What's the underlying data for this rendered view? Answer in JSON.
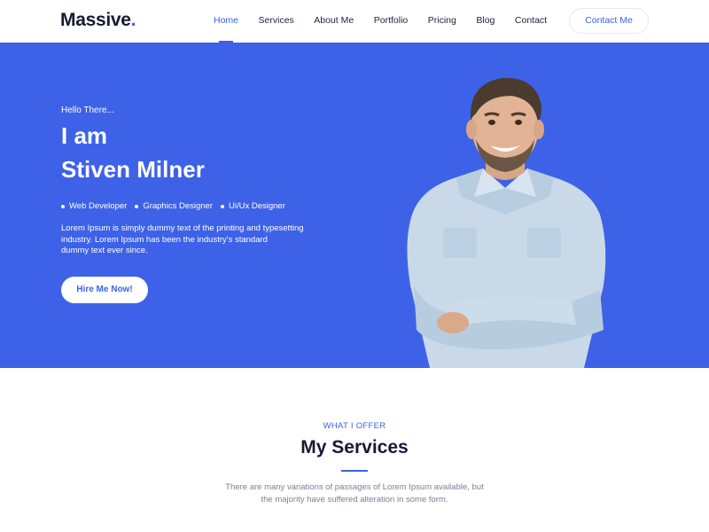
{
  "header": {
    "logo": "Massive",
    "logo_dot": ".",
    "nav": [
      "Home",
      "Services",
      "About Me",
      "Portfolio",
      "Pricing",
      "Blog",
      "Contact"
    ],
    "active_nav": "Home",
    "cta": "Contact Me"
  },
  "hero": {
    "greeting": "Hello There...",
    "title_line1": "I am",
    "title_line2": "Stiven Milner",
    "roles": [
      "Web Developer",
      "Graphics Designer",
      "Ui/Ux Designer"
    ],
    "description_lines": [
      "Lorem Ipsum is simply dummy text of the printing and typesetting",
      "industry. Lorem Ipsum has been the industry's standard",
      "dummy text ever since."
    ],
    "button": "Hire Me Now!"
  },
  "services": {
    "eyebrow": "WHAT I OFFER",
    "title": "My Services",
    "description_lines": [
      "There are many variations of passages of Lorem Ipsum available, but",
      "the majority have suffered alteration in some form."
    ]
  },
  "colors": {
    "accent": "#3d62e8",
    "dark": "#161b33",
    "muted": "#7a8095",
    "white": "#ffffff"
  }
}
